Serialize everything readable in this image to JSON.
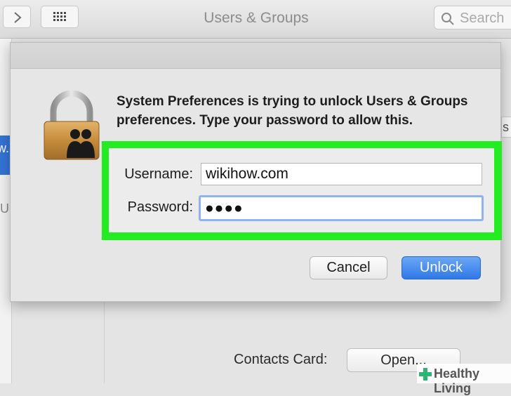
{
  "window": {
    "title": "Users & Groups",
    "search_placeholder": "Search"
  },
  "sidebar": {
    "selected_fragment": "w.",
    "fragment": "U"
  },
  "background": {
    "right_edge_fragment": "s",
    "contacts_label": "Contacts Card:",
    "open_button": "Open..."
  },
  "dialog": {
    "message": "System Preferences is trying to unlock Users & Groups preferences. Type your password to allow this.",
    "username_label": "Username:",
    "username_value": "wikihow.com",
    "password_label": "Password:",
    "password_value": "●●●●",
    "cancel_label": "Cancel",
    "unlock_label": "Unlock"
  },
  "watermark": "Healthy Living",
  "colors": {
    "highlight": "#23ec23",
    "accent": "#3574d6"
  }
}
